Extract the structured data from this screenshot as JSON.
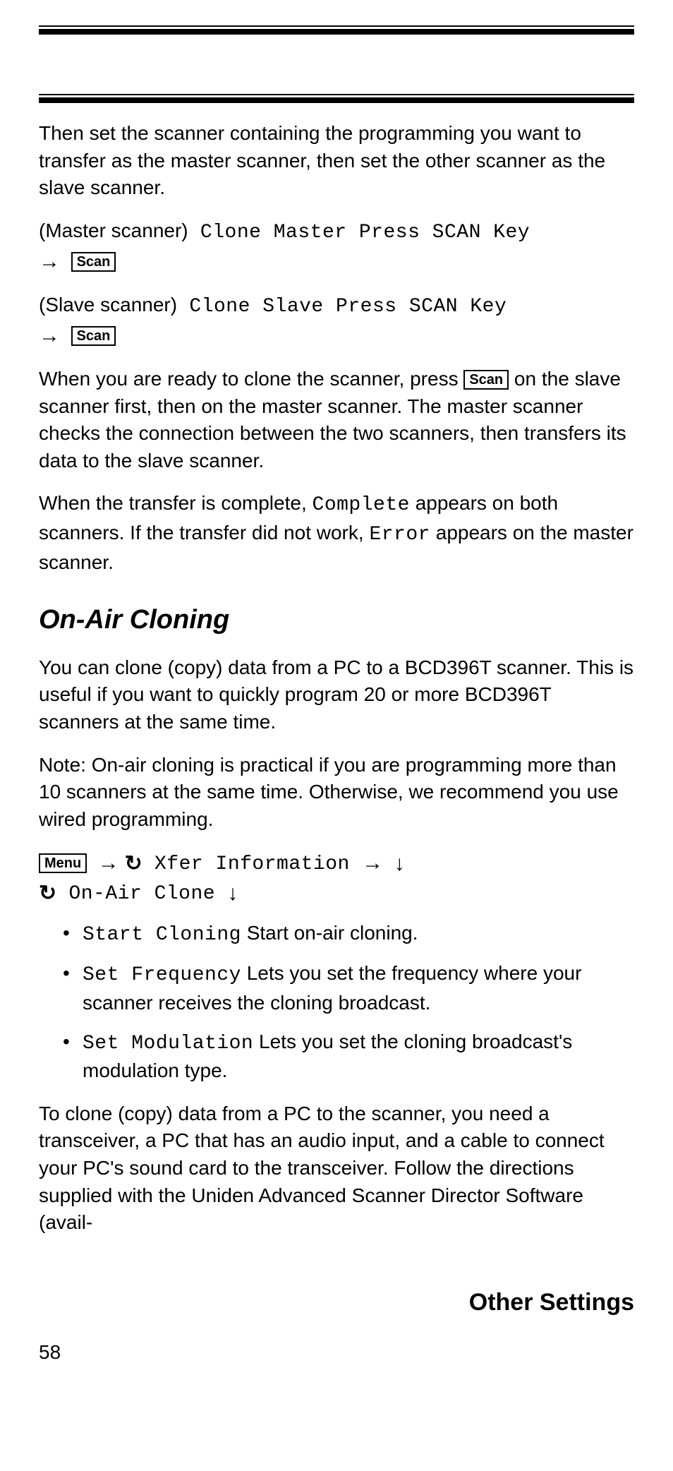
{
  "intro_para": "Then set the scanner containing the programming you want to transfer as the master scanner, then set the other scanner as the slave scanner.",
  "master_label": "(Master scanner)",
  "master_display": " Clone Master Press SCAN Key ",
  "slave_label": "(Slave scanner)",
  "slave_display": " Clone Slave Press SCAN Key ",
  "scan_key": "Scan",
  "menu_key": "Menu",
  "arrow_right_glyph": "→",
  "arrow_down_glyph": "↓",
  "scroll_glyph": "↻",
  "press_scan_1": "When you are ready to clone the scanner, press ",
  "press_scan_2": " on the slave scanner first, then on the master scanner. The master scanner checks the connection between the two scanners, then transfers its data to the slave scanner.",
  "complete_para_1": "When the transfer is complete, ",
  "complete_word": "Complete",
  "complete_para_2": " appears on both scanners. If the transfer did not work, ",
  "error_word": "Error",
  "complete_para_3": " appears on the master scanner.",
  "heading_onair": "On-Air Cloning",
  "onair_intro": "You can clone (copy) data from a PC to a BCD396T scanner. This is useful if you want to quickly program 20 or more BCD396T scanners at the same time.",
  "onair_note": "Note: On-air cloning is practical if you are programming more than 10 scanners at the same time. Otherwise, we recommend you use wired programming.",
  "menu_xfer": " Xfer Information ",
  "menu_onair": " On-Air Clone ",
  "list": [
    {
      "cmd": "Start Cloning",
      "desc": " Start on-air cloning."
    },
    {
      "cmd": "Set Frequency",
      "desc": " Lets you set the frequency where your scanner receives the cloning broadcast."
    },
    {
      "cmd": "Set Modulation",
      "desc": " Lets you set the cloning broadcast's modulation type."
    }
  ],
  "closing_para": "To clone (copy) data from a PC to the scanner, you need a transceiver, a PC that has an audio input, and a cable to connect your PC's sound card to the transceiver. Follow the directions supplied with the Uniden Advanced Scanner Director Software (avail-",
  "footer_title": "Other Settings",
  "page_number": "58"
}
